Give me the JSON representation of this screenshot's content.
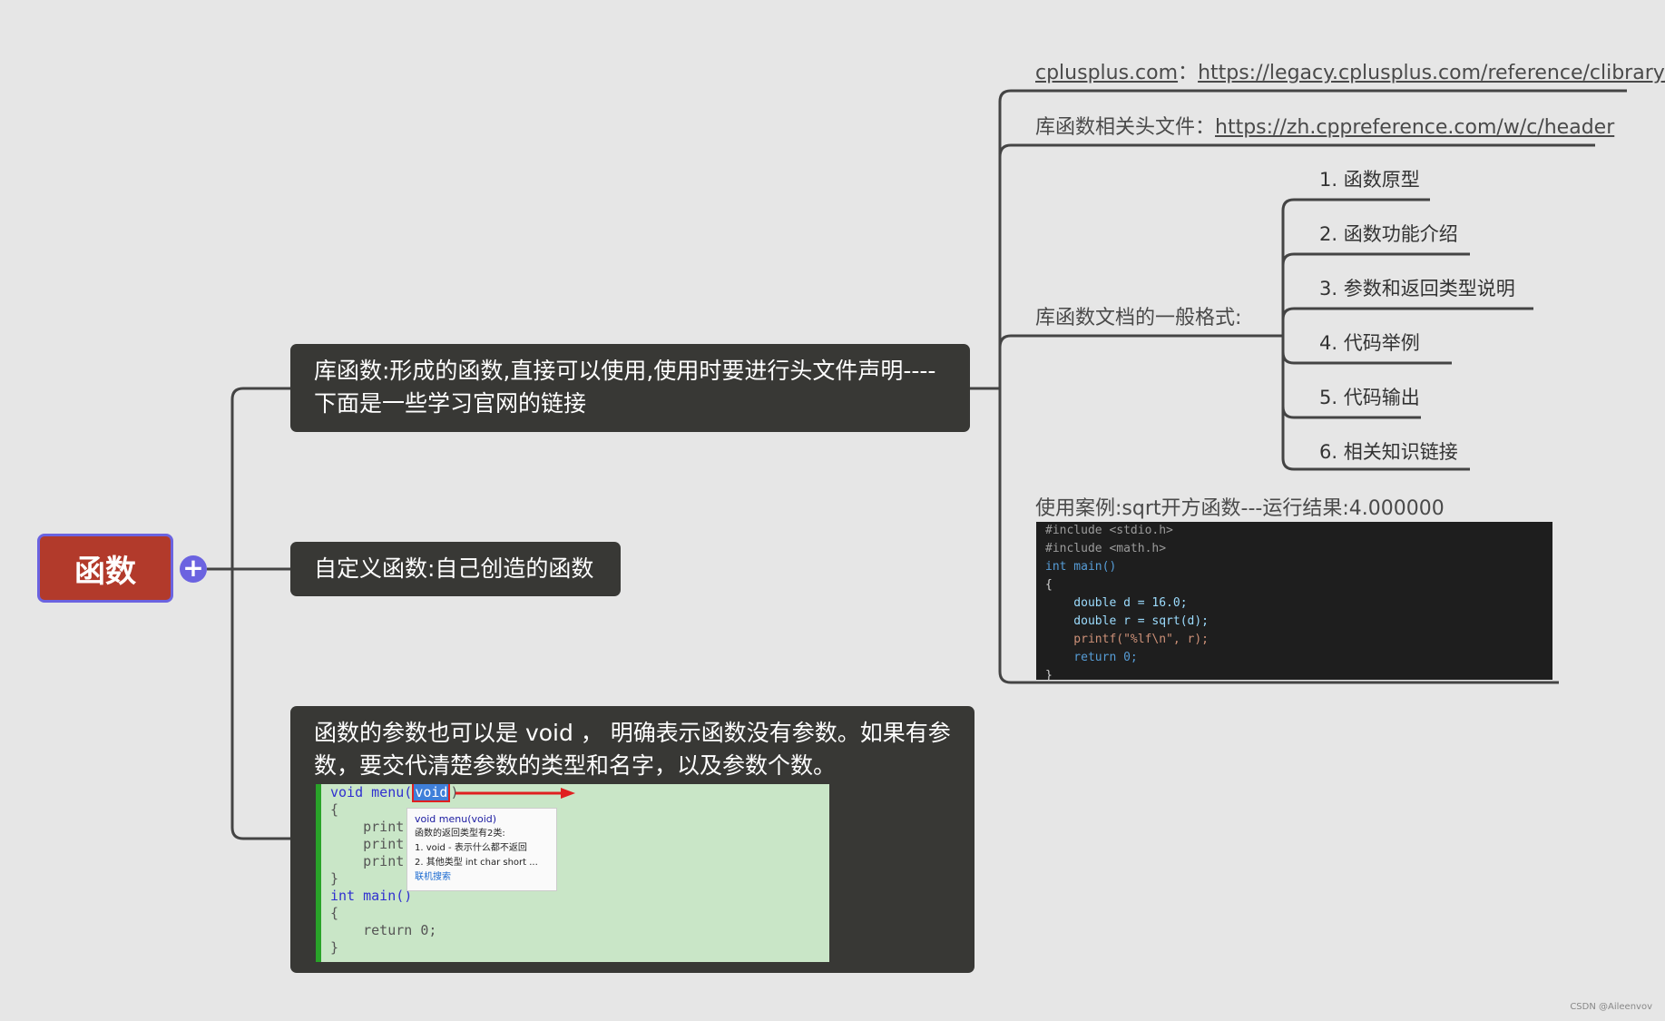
{
  "root": {
    "label": "函数"
  },
  "branches": {
    "library": "库函数:形成的函数,直接可以使用,使用时要进行头文件声明----下面是一些学习官网的链接",
    "custom": "自定义函数:自己创造的函数",
    "void_param": "函数的参数也可以是 void ， 明确表示函数没有参数。如果有参数，要交代清楚参数的类型和名字，以及参数个数。"
  },
  "library_children": {
    "cplusplus_label": "cplusplus.com",
    "cplusplus_sep": "：",
    "cplusplus_url": "https://legacy.cplusplus.com/reference/clibrary/",
    "header_label": "库函数相关头文件：",
    "header_url": "https://zh.cppreference.com/w/c/header",
    "doc_format_label": "库函数文档的一般格式:",
    "doc_format_items": [
      "1. 函数原型",
      "2. 函数功能介绍",
      "3. 参数和返回类型说明",
      "4. 代码举例",
      "5. 代码输出",
      "6. 相关知识链接"
    ],
    "example_label": "使用案例:sqrt开方函数---运行结果:4.000000"
  },
  "sqrt_code": {
    "lines": [
      "#include <stdio.h>",
      "#include <math.h>",
      "int main()",
      "{",
      "    double d = 16.0;",
      "    double r = sqrt(d);",
      "    printf(\"%lf\\n\", r);",
      "    return 0;",
      "}"
    ]
  },
  "void_code": {
    "line1_prefix": "void menu(",
    "line1_void": "void",
    "line1_suffix": ")",
    "lines": [
      "{",
      "    print(\"*******\\n\");",
      "    print(\"*******\\n\");",
      "    print(\"*******\\n\");",
      "}",
      "int main()",
      "{",
      "    return 0;",
      "}"
    ]
  },
  "tooltip": {
    "title": "void menu(void)",
    "line1": "函数的返回类型有2类:",
    "line2": "1. void - 表示什么都不返回",
    "line3": "2. 其他类型 int char short ...",
    "link": "联机搜索"
  },
  "watermark": "CSDN @Aileenvov"
}
